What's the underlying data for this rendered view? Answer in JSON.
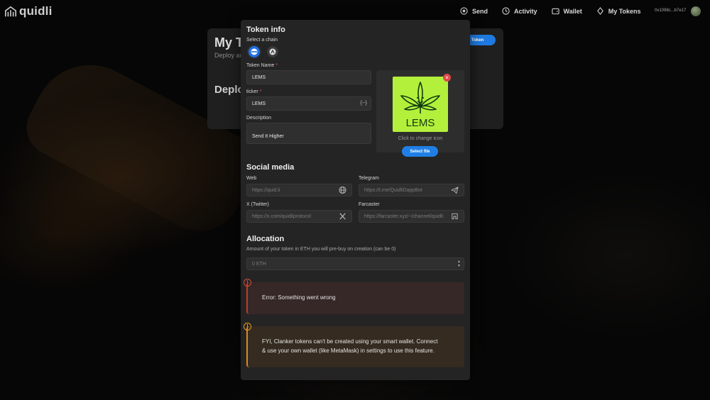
{
  "nav": {
    "logo_text": "quidli",
    "links": [
      {
        "label": "Send",
        "icon": "send-icon"
      },
      {
        "label": "Activity",
        "icon": "activity-icon"
      },
      {
        "label": "Wallet",
        "icon": "wallet-icon"
      },
      {
        "label": "My Tokens",
        "icon": "my-tokens-icon"
      }
    ],
    "address": "0x1098c...b7e17"
  },
  "background_page": {
    "title": "My T",
    "subtitle": "Deploy an",
    "section": "Deplo",
    "button_label": "e a Token"
  },
  "modal": {
    "title": "Token info",
    "chain_label": "Select a chain",
    "chains": [
      {
        "name": "base-chain-icon",
        "selected": true,
        "color": "#1f6fe6"
      },
      {
        "name": "alt-chain-icon",
        "selected": false,
        "color": "#4a4a4a"
      }
    ],
    "token_name": {
      "label": "Token Name",
      "required_mark": "*",
      "value": "LEMS"
    },
    "ticker": {
      "label": "ticker",
      "required_mark": "*",
      "value": "LEMS",
      "suffix": "{--}"
    },
    "description": {
      "label": "Description",
      "value": "Send It Higher"
    },
    "icon_panel": {
      "image_text": "LEMS",
      "image_bg": "#b3f03b",
      "remove_label": "×",
      "change_text": "Click to change icon",
      "select_button": "Select file"
    },
    "social": {
      "title": "Social media",
      "web": {
        "label": "Web",
        "placeholder": "https://quid.li",
        "icon": "globe-icon"
      },
      "telegram": {
        "label": "Telegram",
        "placeholder": "https://t.me/QuidliDappBot",
        "icon": "telegram-icon"
      },
      "x": {
        "label": "X (Twitter)",
        "placeholder": "https://x.com/quidliprotocol",
        "icon": "x-icon"
      },
      "farcaster": {
        "label": "Farcaster",
        "placeholder": "https://farcaster.xyz/~/channel/quidli",
        "icon": "farcaster-icon"
      }
    },
    "allocation": {
      "title": "Allocation",
      "description": "Amount of your token in ETH you will pre-buy on creation (can be 0)",
      "placeholder": "0 ETH"
    },
    "error": {
      "icon_glyph": "!",
      "text": "Error: Something went wrong"
    },
    "warning": {
      "icon_glyph": "!",
      "line1": "FYI, Clanker tokens can't be created using your smart wallet. Connect",
      "line2": "& use your own wallet (like MetaMask) in settings to use this feature."
    }
  },
  "colors": {
    "accent": "#1f7fe6",
    "error": "#c0392b",
    "warning": "#d88a1f",
    "panel": "#242424"
  }
}
